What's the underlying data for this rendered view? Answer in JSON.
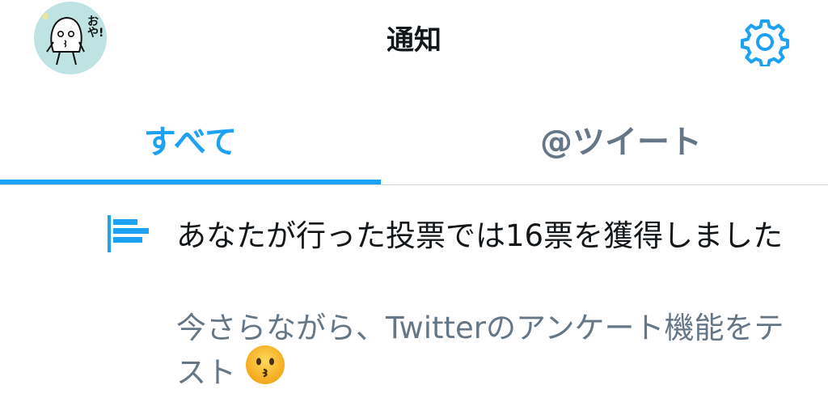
{
  "header": {
    "title": "通知",
    "avatar_text": "おや!"
  },
  "tabs": [
    {
      "label": "すべて",
      "selected": true
    },
    {
      "label": "@ツイート",
      "selected": false
    }
  ],
  "notification": {
    "icon": "poll-icon",
    "message": "あなたが行った投票では16票を獲得しました",
    "tweet_text": "今さらながら、Twitterのアンケート機能をテスト",
    "emoji": "kissing-face-emoji"
  },
  "colors": {
    "accent": "#1da1f2",
    "secondary_text": "#657786",
    "primary_text": "#14171a",
    "avatar_bg": "#bfe3e3"
  }
}
